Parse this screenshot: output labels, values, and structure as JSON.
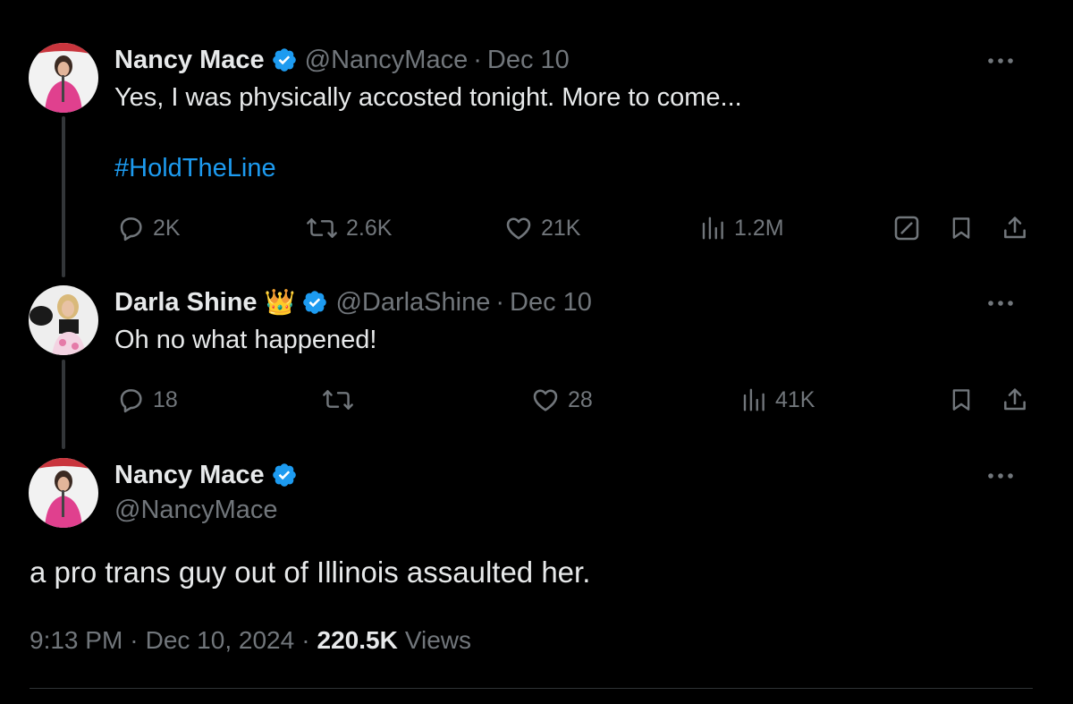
{
  "tweets": [
    {
      "name": "Nancy Mace",
      "handle": "@NancyMace",
      "separator": "·",
      "date": "Dec 10",
      "text": "Yes, I was physically accosted tonight. More to come...",
      "hashtag": "#HoldTheLine",
      "replies": "2K",
      "reposts": "2.6K",
      "likes": "21K",
      "views": "1.2M"
    },
    {
      "name": "Darla Shine",
      "badge_emoji": "👑",
      "handle": "@DarlaShine",
      "separator": "·",
      "date": "Dec 10",
      "text": "Oh no what happened!",
      "replies": "18",
      "reposts": "",
      "likes": "28",
      "views": "41K"
    }
  ],
  "main_tweet": {
    "name": "Nancy Mace",
    "handle": "@NancyMace",
    "text": "a pro trans guy out of Illinois assaulted her.",
    "time": "9:13 PM",
    "date": "Dec 10, 2024",
    "separator": "·",
    "views_count": "220.5K",
    "views_label": "Views"
  },
  "icons": {
    "reply": "reply-icon",
    "repost": "repost-icon",
    "like": "like-icon",
    "views": "views-icon",
    "grok": "grok-icon",
    "bookmark": "bookmark-icon",
    "share": "share-icon",
    "more": "more-icon",
    "verified": "verified-badge-icon"
  },
  "colors": {
    "background": "#000000",
    "text": "#e7e9ea",
    "muted": "#71767b",
    "accent": "#1d9bf0",
    "thread_line": "#333639"
  }
}
